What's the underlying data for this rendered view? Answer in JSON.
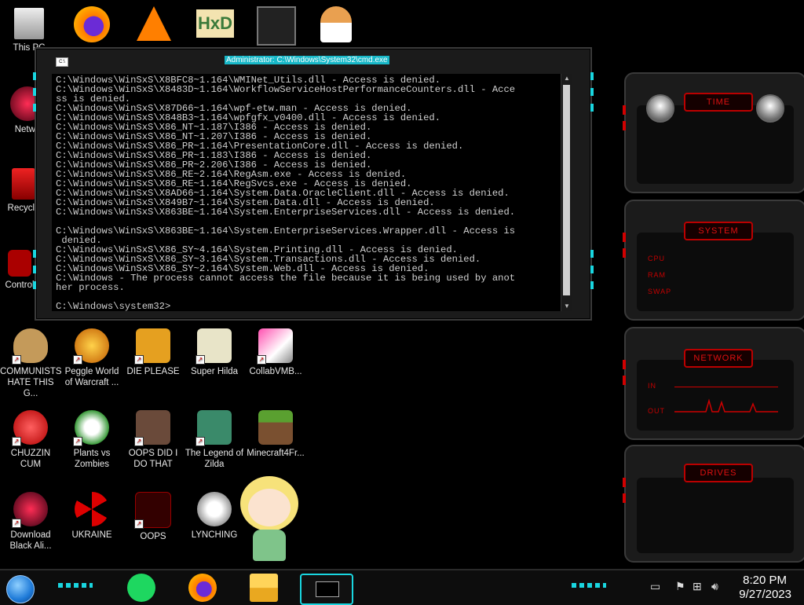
{
  "desktop_icons": [
    {
      "id": "this-pc",
      "label": "This PC"
    },
    {
      "id": "network",
      "label": "Netwo"
    },
    {
      "id": "recycle",
      "label": "Recycle"
    },
    {
      "id": "control",
      "label": "Control"
    },
    {
      "id": "communists",
      "label": "COMMUNISTS HATE THIS G..."
    },
    {
      "id": "peggle",
      "label": "Peggle World of Warcraft ..."
    },
    {
      "id": "die-please",
      "label": "DIE PLEASE"
    },
    {
      "id": "super-hilda",
      "label": "Super Hilda"
    },
    {
      "id": "collabvm",
      "label": "CollabVMB..."
    },
    {
      "id": "chuzzin",
      "label": "CHUZZIN CUM"
    },
    {
      "id": "plants",
      "label": "Plants vs Zombies"
    },
    {
      "id": "oops-did",
      "label": "OOPS DID I DO THAT"
    },
    {
      "id": "zilda",
      "label": "The Legend of Zilda"
    },
    {
      "id": "minecraft",
      "label": "Minecraft4Fr..."
    },
    {
      "id": "download-black",
      "label": "Download Black Ali..."
    },
    {
      "id": "ukraine",
      "label": "UKRAINE"
    },
    {
      "id": "oops",
      "label": "OOPS"
    },
    {
      "id": "lynching",
      "label": "LYNCHING"
    }
  ],
  "cmd": {
    "title": "Administrator: C:\\Windows\\System32\\cmd.exe",
    "icon_text": "C:\\",
    "output": "C:\\Windows\\WinSxS\\X8BFC8~1.164\\WMINet_Utils.dll - Access is denied.\nC:\\Windows\\WinSxS\\X8483D~1.164\\WorkflowServiceHostPerformanceCounters.dll - Acce\nss is denied.\nC:\\Windows\\WinSxS\\X87D66~1.164\\wpf-etw.man - Access is denied.\nC:\\Windows\\WinSxS\\X848B3~1.164\\wpfgfx_v0400.dll - Access is denied.\nC:\\Windows\\WinSxS\\X86_NT~1.187\\I386 - Access is denied.\nC:\\Windows\\WinSxS\\X86_NT~1.207\\I386 - Access is denied.\nC:\\Windows\\WinSxS\\X86_PR~1.164\\PresentationCore.dll - Access is denied.\nC:\\Windows\\WinSxS\\X86_PR~1.183\\I386 - Access is denied.\nC:\\Windows\\WinSxS\\X86_PR~2.206\\I386 - Access is denied.\nC:\\Windows\\WinSxS\\X86_RE~2.164\\RegAsm.exe - Access is denied.\nC:\\Windows\\WinSxS\\X86_RE~1.164\\RegSvcs.exe - Access is denied.\nC:\\Windows\\WinSxS\\X8AD66~1.164\\System.Data.OracleClient.dll - Access is denied.\nC:\\Windows\\WinSxS\\X849B7~1.164\\System.Data.dll - Access is denied.\nC:\\Windows\\WinSxS\\X863BE~1.164\\System.EnterpriseServices.dll - Access is denied.\n\nC:\\Windows\\WinSxS\\X863BE~1.164\\System.EnterpriseServices.Wrapper.dll - Access is\n denied.\nC:\\Windows\\WinSxS\\X86_SY~4.164\\System.Printing.dll - Access is denied.\nC:\\Windows\\WinSxS\\X86_SY~3.164\\System.Transactions.dll - Access is denied.\nC:\\Windows\\WinSxS\\X86_SY~2.164\\System.Web.dll - Access is denied.\nC:\\Windows - The process cannot access the file because it is being used by anot\nher process.\n\nC:\\Windows\\system32>"
  },
  "gadgets": {
    "time": {
      "header": "TIME"
    },
    "system": {
      "header": "SYSTEM",
      "labels": [
        "CPU",
        "RAM",
        "SWAP"
      ]
    },
    "network": {
      "header": "NETWORK",
      "labels": [
        "IN",
        "OUT"
      ]
    },
    "drives": {
      "header": "DRIVES"
    }
  },
  "taskbar": {
    "clock_time": "8:20 PM",
    "clock_date": "9/27/2023",
    "apps": [
      "spotify-icon",
      "firefox-icon",
      "file-explorer-icon",
      "cmd-icon"
    ]
  }
}
